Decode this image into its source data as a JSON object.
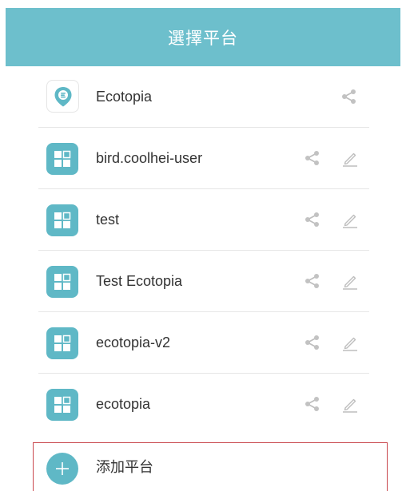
{
  "header": {
    "title": "選擇平台"
  },
  "colors": {
    "header_bg": "#6dbfcc",
    "icon_bg": "#5fb8c6",
    "add_highlight_border": "#c9474d"
  },
  "platforms": [
    {
      "label": "Ecotopia",
      "icon": "ecotopia-logo-icon",
      "actions": [
        "share-icon"
      ]
    },
    {
      "label": "bird.coolhei-user",
      "icon": "grid-app-icon",
      "actions": [
        "share-icon",
        "edit-pencil-icon"
      ]
    },
    {
      "label": "test",
      "icon": "grid-app-icon",
      "actions": [
        "share-icon",
        "edit-pencil-icon"
      ]
    },
    {
      "label": "Test Ecotopia",
      "icon": "grid-app-icon",
      "actions": [
        "share-icon",
        "edit-pencil-icon"
      ]
    },
    {
      "label": "ecotopia-v2",
      "icon": "grid-app-icon",
      "actions": [
        "share-icon",
        "edit-pencil-icon"
      ]
    },
    {
      "label": "ecotopia",
      "icon": "grid-app-icon",
      "actions": [
        "share-icon",
        "edit-pencil-icon"
      ]
    }
  ],
  "add_platform": {
    "label": "添加平台",
    "icon": "plus-circle-icon"
  }
}
